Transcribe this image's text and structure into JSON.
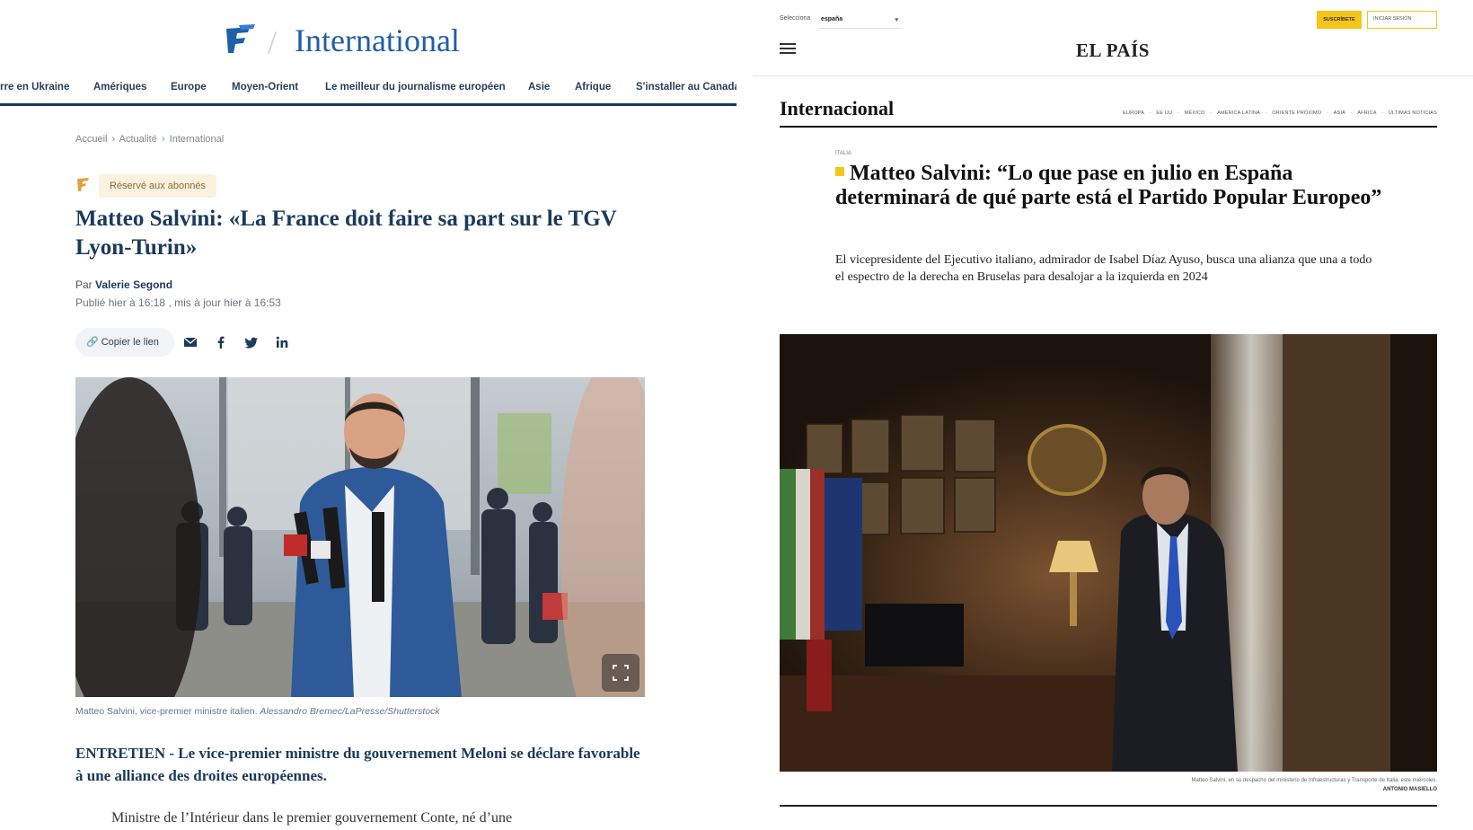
{
  "figaro": {
    "section_title": "International",
    "nav": [
      "rre en Ukraine",
      "Amériques",
      "Europe",
      "Moyen-Orient",
      "Le meilleur du journalisme européen",
      "Asie",
      "Afrique",
      "S'installer au Canada"
    ],
    "breadcrumb": [
      "Accueil",
      "›",
      "Actualité",
      "›",
      "International"
    ],
    "badge": "Réservé aux abonnés",
    "title": "Matteo Salvini: «La France doit faire sa part sur le TGV Lyon-Turin»",
    "byline_prefix": "Par",
    "author": "Valerie Segond",
    "published": "Publié hier à 16:18 , mis à jour hier à 16:53",
    "share": {
      "copy_label": "Copier le lien",
      "icons": [
        "mail-icon",
        "facebook-icon",
        "twitter-icon",
        "linkedin-icon"
      ]
    },
    "photo_caption": "Matteo Salvini, vice-premier ministre italien.",
    "photo_credit": "Alessandro Bremec/LaPresse/Shutterstock",
    "lead": "ENTRETIEN - Le vice-premier ministre du gouvernement Meloni se déclare favorable à une alliance des droites européennes.",
    "body_start": "Ministre de l’Intérieur dans le premier gouvernement Conte, né d’une",
    "colors": {
      "brand": "#1f5fa8",
      "navy": "#1b3a5c",
      "badge_bg": "#fbf1df"
    }
  },
  "elpais": {
    "edition_label": "Selecciona",
    "edition_value": "españa",
    "subscribe_label": "SUSCRÍBETE",
    "login_label": "INICIAR SESIÓN",
    "logo": "EL PAÍS",
    "section_title": "Internacional",
    "subnav": [
      "EUROPA",
      "·",
      "EE UU",
      "·",
      "MÉXICO",
      "·",
      "AMÉRICA LATINA",
      "·",
      "ORIENTE PRÓXIMO",
      "·",
      "ASIA",
      "·",
      "ÁFRICA",
      "·",
      "ÚLTIMAS NOTICIAS"
    ],
    "tag": "ITALIA",
    "title": "Matteo Salvini: “Lo que pase en julio en España determinará de qué parte está el Partido Popular Europeo”",
    "standfirst": "El vicepresidente del Ejecutivo italiano, admirador de Isabel Díaz Ayuso, busca una alianza que una a todo el espectro de la derecha en Bruselas para desalojar a la izquierda en 2024",
    "photo_caption": "Matteo Salvini, en su despacho del ministerio de Infraestructuras y Transporte de Italia, este miércoles.",
    "photo_credit": "ANTONIO MASIELLO",
    "colors": {
      "accent": "#f5c518"
    }
  }
}
